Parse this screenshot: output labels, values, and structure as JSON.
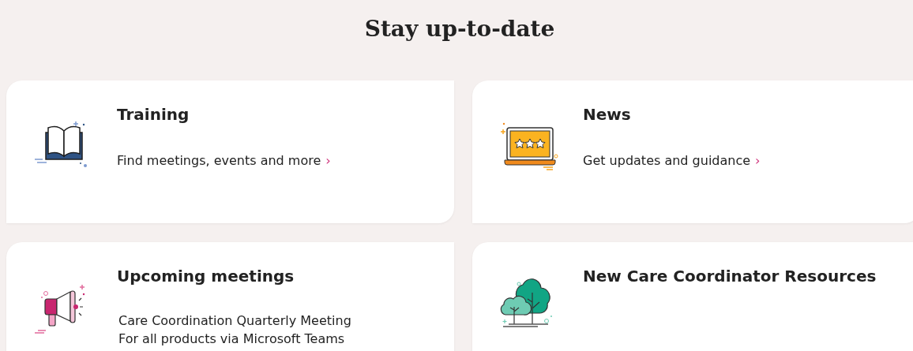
{
  "heading": "Stay up-to-date",
  "cards": [
    {
      "kind": "link",
      "title": "Training",
      "link": "Find meetings, events and more",
      "arrow": "›"
    },
    {
      "kind": "link",
      "title": "News",
      "link": "Get updates and guidance",
      "arrow": "›"
    },
    {
      "kind": "lines",
      "title": "Upcoming meetings",
      "lines": [
        "Care Coordination Quarterly Meeting",
        "For all products via Microsoft Teams"
      ]
    },
    {
      "kind": "plain",
      "title": "New Care Coordinator Resources"
    }
  ]
}
